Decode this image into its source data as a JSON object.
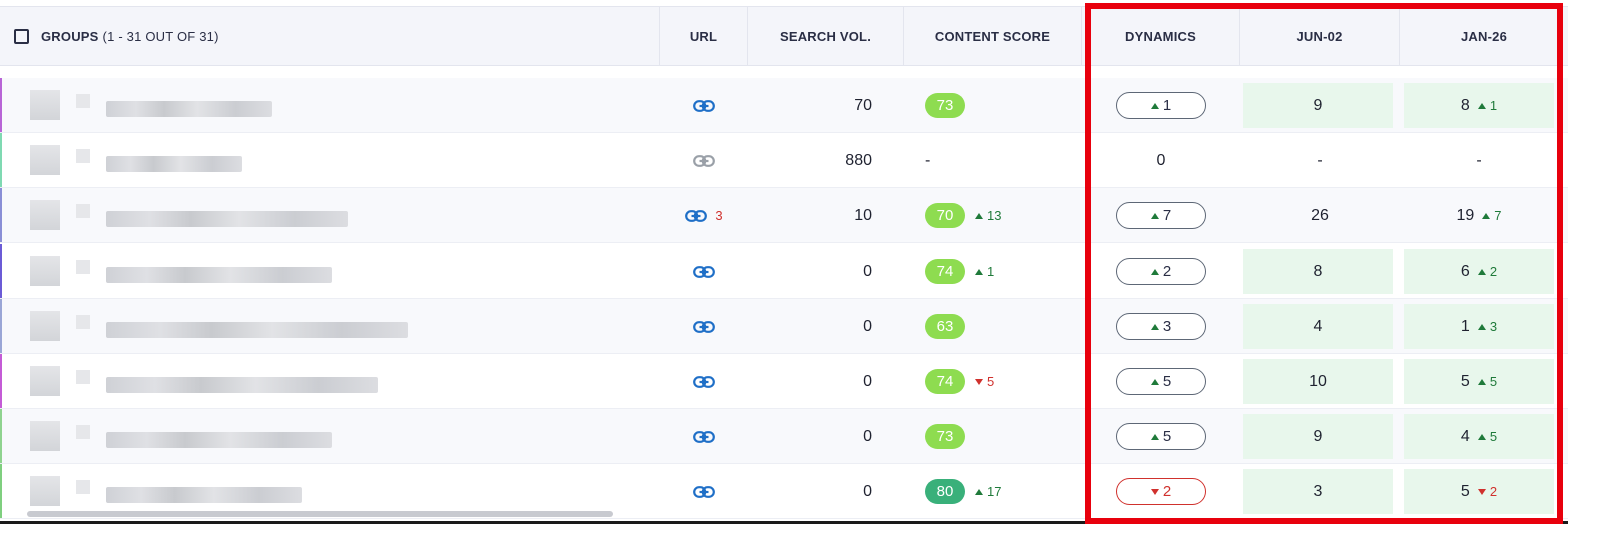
{
  "header": {
    "groups_label": "GROUPS",
    "groups_count": "(1 - 31 OUT OF 31)",
    "url": "URL",
    "search_vol": "SEARCH VOL.",
    "content_score": "CONTENT SCORE",
    "dynamics": "DYNAMICS",
    "date1": "JUN-02",
    "date2": "JAN-26"
  },
  "colors": {
    "score_light_green": "#8edc50",
    "score_dark_green": "#39b07a",
    "link_blue": "#1f6fc7",
    "link_gray": "#9aa0a8",
    "highlight_frame": "#e8000d"
  },
  "rows": [
    {
      "url_icon": "link-icon",
      "url_active": true,
      "url_count": "",
      "search_vol": "70",
      "score": "73",
      "score_delta": "",
      "score_dir": "",
      "dyn": "1",
      "dyn_dir": "up",
      "d1": "9",
      "d1_green": true,
      "d2": "8",
      "d2_delta": "1",
      "d2_dir": "up",
      "d2_green": true
    },
    {
      "url_icon": "link-icon",
      "url_active": false,
      "url_count": "",
      "search_vol": "880",
      "score": "-",
      "score_delta": "",
      "score_dir": "",
      "dyn": "0",
      "dyn_dir": "",
      "d1": "-",
      "d1_green": false,
      "d2": "-",
      "d2_delta": "",
      "d2_dir": "",
      "d2_green": false
    },
    {
      "url_icon": "link-icon",
      "url_active": true,
      "url_count": "3",
      "search_vol": "10",
      "score": "70",
      "score_delta": "13",
      "score_dir": "up",
      "dyn": "7",
      "dyn_dir": "up",
      "d1": "26",
      "d1_green": false,
      "d2": "19",
      "d2_delta": "7",
      "d2_dir": "up",
      "d2_green": false
    },
    {
      "url_icon": "link-icon",
      "url_active": true,
      "url_count": "",
      "search_vol": "0",
      "score": "74",
      "score_delta": "1",
      "score_dir": "up",
      "dyn": "2",
      "dyn_dir": "up",
      "d1": "8",
      "d1_green": true,
      "d2": "6",
      "d2_delta": "2",
      "d2_dir": "up",
      "d2_green": true
    },
    {
      "url_icon": "link-icon",
      "url_active": true,
      "url_count": "",
      "search_vol": "0",
      "score": "63",
      "score_delta": "",
      "score_dir": "",
      "dyn": "3",
      "dyn_dir": "up",
      "d1": "4",
      "d1_green": true,
      "d2": "1",
      "d2_delta": "3",
      "d2_dir": "up",
      "d2_green": true
    },
    {
      "url_icon": "link-icon",
      "url_active": true,
      "url_count": "",
      "search_vol": "0",
      "score": "74",
      "score_delta": "5",
      "score_dir": "down",
      "dyn": "5",
      "dyn_dir": "up",
      "d1": "10",
      "d1_green": true,
      "d2": "5",
      "d2_delta": "5",
      "d2_dir": "up",
      "d2_green": true
    },
    {
      "url_icon": "link-icon",
      "url_active": true,
      "url_count": "",
      "search_vol": "0",
      "score": "73",
      "score_delta": "",
      "score_dir": "",
      "dyn": "5",
      "dyn_dir": "up",
      "d1": "9",
      "d1_green": true,
      "d2": "4",
      "d2_delta": "5",
      "d2_dir": "up",
      "d2_green": true
    },
    {
      "url_icon": "link-icon",
      "url_active": true,
      "url_count": "",
      "search_vol": "0",
      "score": "80",
      "score_delta": "17",
      "score_dir": "up",
      "score_dark": true,
      "dyn": "2",
      "dyn_dir": "down",
      "d1": "3",
      "d1_green": true,
      "d2": "5",
      "d2_delta": "2",
      "d2_dir": "down",
      "d2_green": true
    }
  ]
}
